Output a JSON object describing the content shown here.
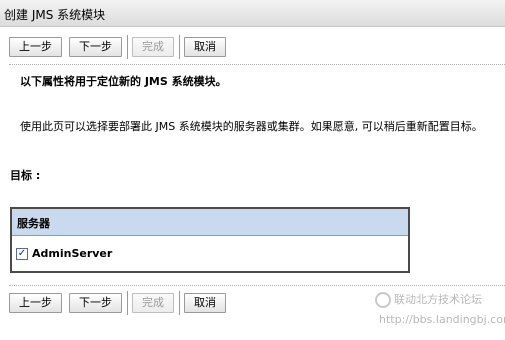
{
  "window": {
    "title": "创建 JMS 系统模块"
  },
  "buttons": {
    "back": "上一步",
    "next": "下一步",
    "finish": "完成",
    "cancel": "取消"
  },
  "content": {
    "heading": "以下属性将用于定位新的 JMS 系统模块。",
    "description": "使用此页可以选择要部署此 JMS 系统模块的服务器或集群。如果愿意, 可以稍后重新配置目标。",
    "target_label": "目标 :"
  },
  "servers_table": {
    "header": "服务器",
    "rows": [
      {
        "name": "AdminServer",
        "checked": true
      }
    ]
  },
  "watermark": {
    "text": "联动北方技术论坛",
    "url": "http://bbs.landingbj.com"
  }
}
